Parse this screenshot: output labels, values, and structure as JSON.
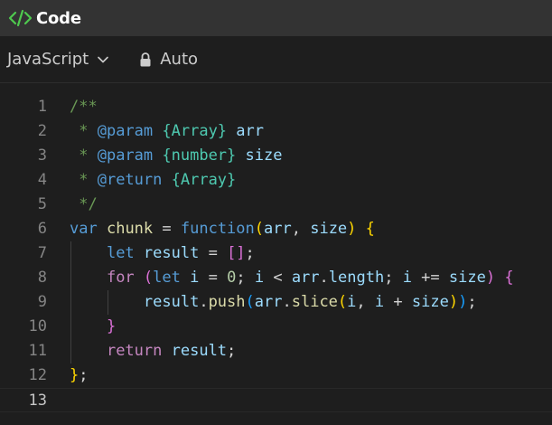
{
  "header": {
    "title": "Code",
    "icon": "code-icon",
    "icon_color": "#4ec94e"
  },
  "toolbar": {
    "language": "JavaScript",
    "language_icon": "chevron-down-icon",
    "mode_icon": "lock-icon",
    "mode": "Auto"
  },
  "colors": {
    "background": "#1e1e1e",
    "header_background": "#333333",
    "comment": "#6a9955",
    "keyword": "#569cd6",
    "control": "#c586c0",
    "function": "#dcdcaa",
    "variable": "#9cdcfe",
    "type": "#4ec9b0",
    "number": "#b5cea8",
    "bracket_level1": "#ffd700",
    "bracket_level2": "#da70d6",
    "bracket_level3": "#179fff"
  },
  "editor": {
    "active_line": 13,
    "lines": [
      {
        "number": "1",
        "indent": 0,
        "tokens": [
          {
            "t": "/**",
            "c": "comment"
          }
        ]
      },
      {
        "number": "2",
        "indent": 0,
        "tokens": [
          {
            "t": " * ",
            "c": "comment"
          },
          {
            "t": "@param",
            "c": "doctag"
          },
          {
            "t": " ",
            "c": "comment"
          },
          {
            "t": "{Array}",
            "c": "doctype"
          },
          {
            "t": " ",
            "c": "comment"
          },
          {
            "t": "arr",
            "c": "docparam"
          }
        ]
      },
      {
        "number": "3",
        "indent": 0,
        "tokens": [
          {
            "t": " * ",
            "c": "comment"
          },
          {
            "t": "@param",
            "c": "doctag"
          },
          {
            "t": " ",
            "c": "comment"
          },
          {
            "t": "{number}",
            "c": "doctype"
          },
          {
            "t": " ",
            "c": "comment"
          },
          {
            "t": "size",
            "c": "docparam"
          }
        ]
      },
      {
        "number": "4",
        "indent": 0,
        "tokens": [
          {
            "t": " * ",
            "c": "comment"
          },
          {
            "t": "@return",
            "c": "doctag"
          },
          {
            "t": " ",
            "c": "comment"
          },
          {
            "t": "{Array}",
            "c": "doctype"
          }
        ]
      },
      {
        "number": "5",
        "indent": 0,
        "tokens": [
          {
            "t": " */",
            "c": "comment"
          }
        ]
      },
      {
        "number": "6",
        "indent": 0,
        "tokens": [
          {
            "t": "var",
            "c": "keyword"
          },
          {
            "t": " ",
            "c": "punct"
          },
          {
            "t": "chunk",
            "c": "function"
          },
          {
            "t": " = ",
            "c": "punct"
          },
          {
            "t": "function",
            "c": "keyword"
          },
          {
            "t": "(",
            "c": "bracket1"
          },
          {
            "t": "arr",
            "c": "variable"
          },
          {
            "t": ", ",
            "c": "punct"
          },
          {
            "t": "size",
            "c": "variable"
          },
          {
            "t": ")",
            "c": "bracket1"
          },
          {
            "t": " ",
            "c": "punct"
          },
          {
            "t": "{",
            "c": "bracket1"
          }
        ]
      },
      {
        "number": "7",
        "indent": 1,
        "tokens": [
          {
            "t": "    ",
            "c": "punct"
          },
          {
            "t": "let",
            "c": "keyword"
          },
          {
            "t": " ",
            "c": "punct"
          },
          {
            "t": "result",
            "c": "variable"
          },
          {
            "t": " = ",
            "c": "punct"
          },
          {
            "t": "[]",
            "c": "bracket2"
          },
          {
            "t": ";",
            "c": "punct"
          }
        ]
      },
      {
        "number": "8",
        "indent": 1,
        "tokens": [
          {
            "t": "    ",
            "c": "punct"
          },
          {
            "t": "for",
            "c": "control"
          },
          {
            "t": " ",
            "c": "punct"
          },
          {
            "t": "(",
            "c": "bracket2"
          },
          {
            "t": "let",
            "c": "keyword"
          },
          {
            "t": " ",
            "c": "punct"
          },
          {
            "t": "i",
            "c": "variable"
          },
          {
            "t": " = ",
            "c": "punct"
          },
          {
            "t": "0",
            "c": "number"
          },
          {
            "t": "; ",
            "c": "punct"
          },
          {
            "t": "i",
            "c": "variable"
          },
          {
            "t": " < ",
            "c": "punct"
          },
          {
            "t": "arr",
            "c": "variable"
          },
          {
            "t": ".",
            "c": "punct"
          },
          {
            "t": "length",
            "c": "variable"
          },
          {
            "t": "; ",
            "c": "punct"
          },
          {
            "t": "i",
            "c": "variable"
          },
          {
            "t": " += ",
            "c": "punct"
          },
          {
            "t": "size",
            "c": "variable"
          },
          {
            "t": ")",
            "c": "bracket2"
          },
          {
            "t": " ",
            "c": "punct"
          },
          {
            "t": "{",
            "c": "bracket2"
          }
        ]
      },
      {
        "number": "9",
        "indent": 2,
        "tokens": [
          {
            "t": "        ",
            "c": "punct"
          },
          {
            "t": "result",
            "c": "variable"
          },
          {
            "t": ".",
            "c": "punct"
          },
          {
            "t": "push",
            "c": "function"
          },
          {
            "t": "(",
            "c": "bracket3"
          },
          {
            "t": "arr",
            "c": "variable"
          },
          {
            "t": ".",
            "c": "punct"
          },
          {
            "t": "slice",
            "c": "function"
          },
          {
            "t": "(",
            "c": "bracket1"
          },
          {
            "t": "i",
            "c": "variable"
          },
          {
            "t": ", ",
            "c": "punct"
          },
          {
            "t": "i",
            "c": "variable"
          },
          {
            "t": " + ",
            "c": "punct"
          },
          {
            "t": "size",
            "c": "variable"
          },
          {
            "t": ")",
            "c": "bracket1"
          },
          {
            "t": ")",
            "c": "bracket3"
          },
          {
            "t": ";",
            "c": "punct"
          }
        ]
      },
      {
        "number": "10",
        "indent": 1,
        "tokens": [
          {
            "t": "    ",
            "c": "punct"
          },
          {
            "t": "}",
            "c": "bracket2"
          }
        ]
      },
      {
        "number": "11",
        "indent": 1,
        "tokens": [
          {
            "t": "    ",
            "c": "punct"
          },
          {
            "t": "return",
            "c": "control"
          },
          {
            "t": " ",
            "c": "punct"
          },
          {
            "t": "result",
            "c": "variable"
          },
          {
            "t": ";",
            "c": "punct"
          }
        ]
      },
      {
        "number": "12",
        "indent": 0,
        "tokens": [
          {
            "t": "}",
            "c": "bracket1"
          },
          {
            "t": ";",
            "c": "punct"
          }
        ]
      },
      {
        "number": "13",
        "indent": 0,
        "tokens": []
      }
    ]
  }
}
